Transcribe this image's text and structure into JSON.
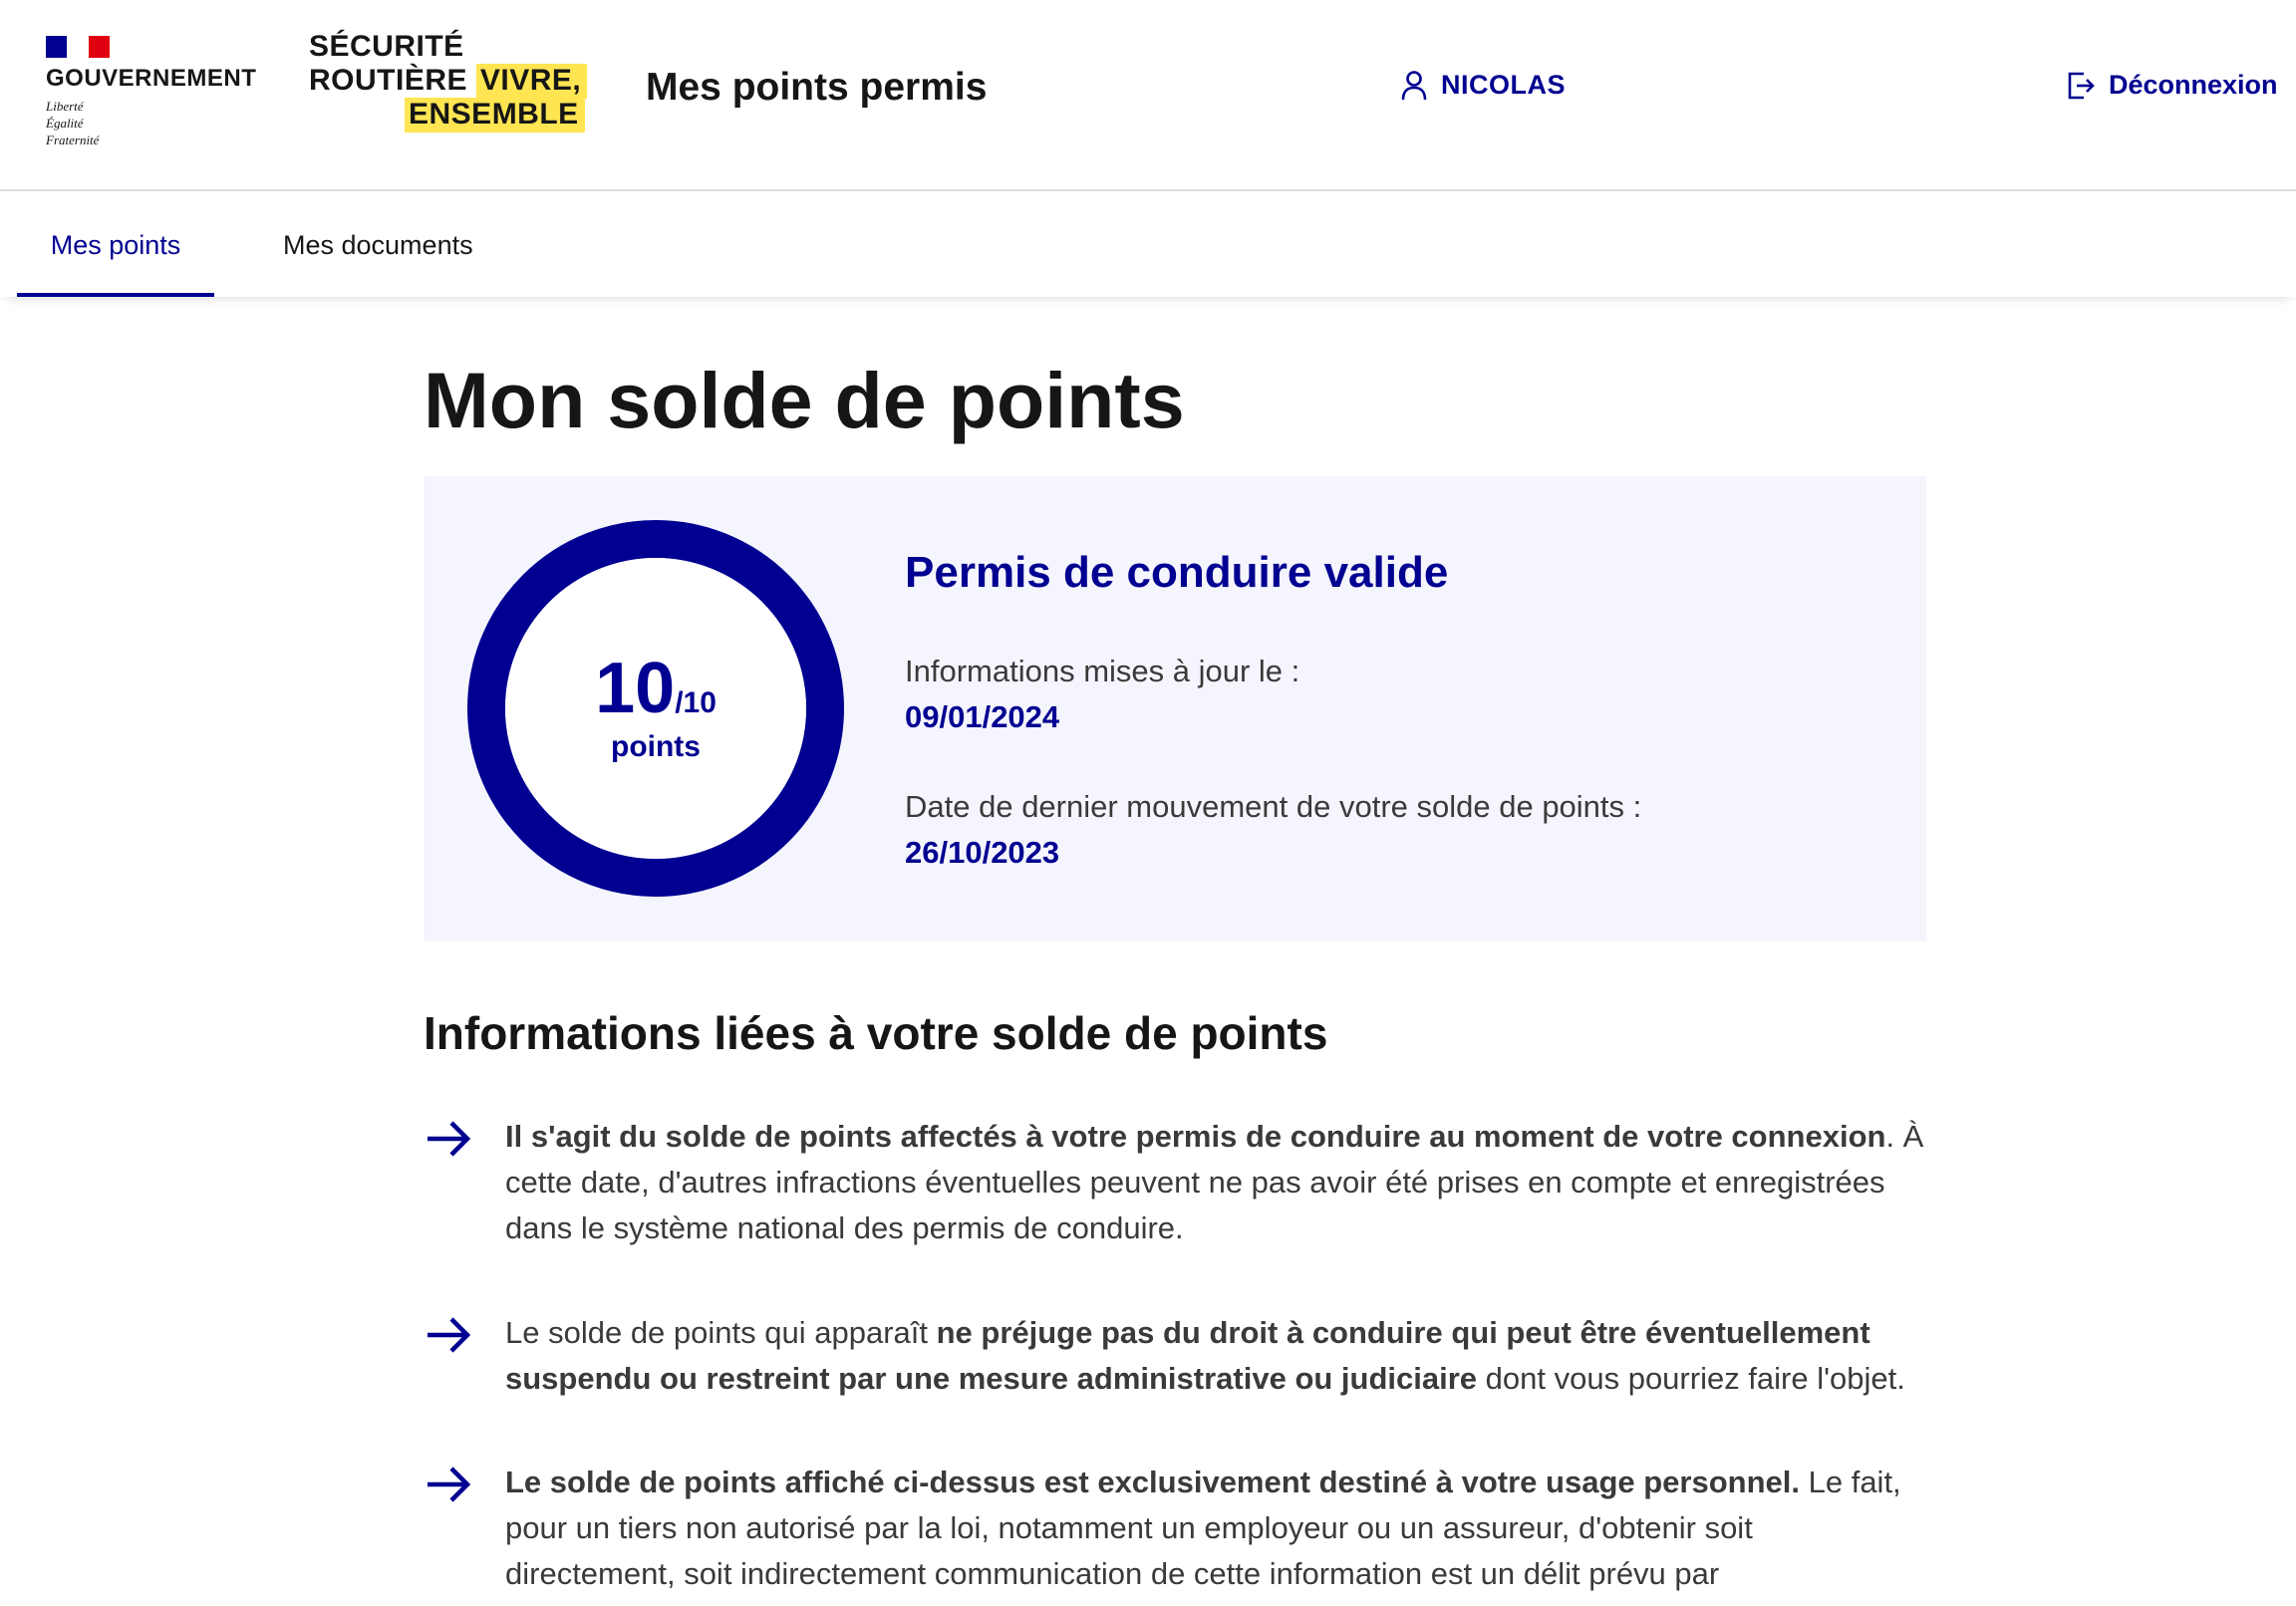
{
  "header": {
    "gov_name": "GOUVERNEMENT",
    "gov_motto": [
      "Liberté",
      "Égalité",
      "Fraternité"
    ],
    "sr_line1": "SÉCURITÉ",
    "sr_line2a": "ROUTIÈRE",
    "sr_line2b": "VIVRE,",
    "sr_line3": "ENSEMBLE",
    "service_title": "Mes points permis",
    "user_name": "NICOLAS",
    "logout_label": "Déconnexion"
  },
  "nav": {
    "tabs": [
      {
        "label": "Mes points",
        "active": true
      },
      {
        "label": "Mes documents",
        "active": false
      }
    ]
  },
  "main": {
    "page_title": "Mon solde de points",
    "card": {
      "score": "10",
      "max": "/10",
      "unit": "points",
      "score_fraction": 1.0,
      "status": "Permis de conduire valide",
      "updated_label": "Informations mises à jour le :",
      "updated_value": "09/01/2024",
      "last_move_label": "Date de dernier mouvement de votre solde de points :",
      "last_move_value": "26/10/2023"
    },
    "section_title": "Informations liées à votre solde de points",
    "items": [
      {
        "bold1": "Il s'agit du solde de points affectés à votre permis de conduire au moment de votre connexion",
        "text1": ". À cette date, d'autres infractions éventuelles peuvent ne pas avoir été prises en compte et enregistrées dans le système national des permis de conduire."
      },
      {
        "text1": "Le solde de points qui apparaît ",
        "bold1": "ne préjuge pas du droit à conduire qui peut être éventuellement suspendu ou restreint par une mesure administrative ou judiciaire",
        "text2": " dont vous pourriez faire l'objet."
      },
      {
        "bold1": "Le solde de points affiché ci-dessus est exclusivement destiné à votre usage personnel.",
        "text1": " Le fait, pour un tiers non autorisé par la loi, notamment un employeur ou un assureur, d'obtenir soit directement, soit indirectement communication de cette information est un délit prévu par"
      }
    ]
  },
  "colors": {
    "primary": "#000091",
    "marianne_red": "#e1000f",
    "highlight_yellow": "#ffe552",
    "card_bg": "#f5f5fe"
  }
}
